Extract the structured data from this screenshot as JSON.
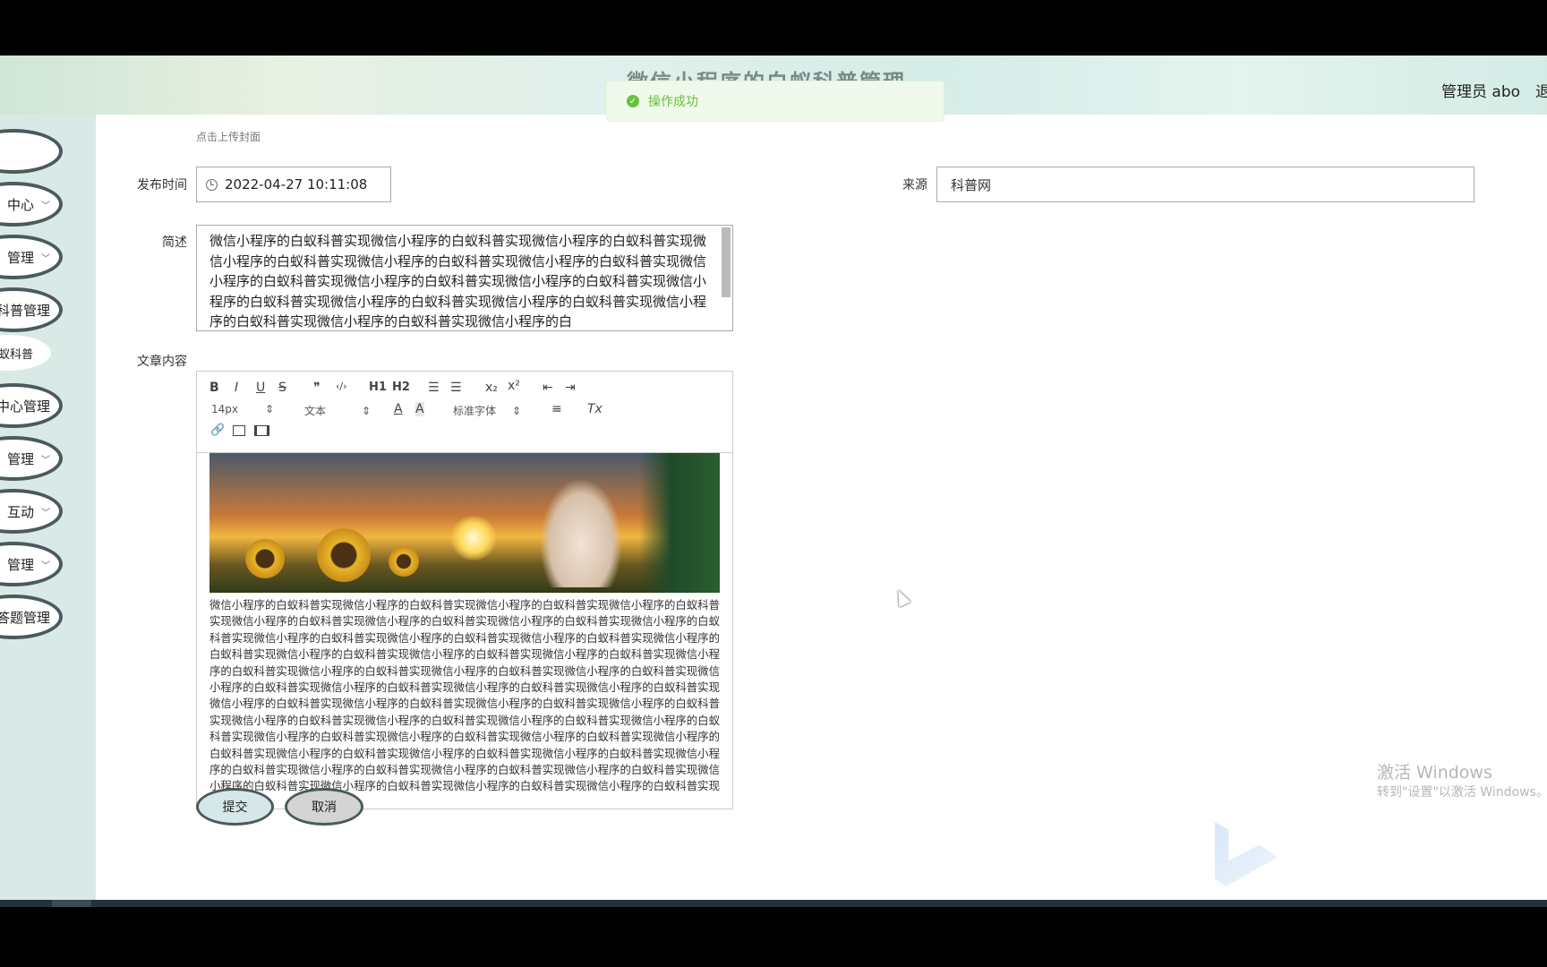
{
  "header": {
    "site_title": "微信小程序的白蚁科普管理",
    "admin_label": "管理员 abo",
    "logout_label": "退"
  },
  "toast": {
    "message": "操作成功"
  },
  "sidebar": {
    "items": [
      {
        "label": ""
      },
      {
        "label": "中心"
      },
      {
        "label": "管理"
      },
      {
        "label": "科普管理"
      },
      {
        "label": "蚁科普"
      },
      {
        "label": "中心管理"
      },
      {
        "label": "管理"
      },
      {
        "label": "互动"
      },
      {
        "label": "管理"
      },
      {
        "label": "答题管理"
      }
    ]
  },
  "form": {
    "upload_hint": "点击上传封面",
    "publish_time_label": "发布时间",
    "publish_time_value": "2022-04-27 10:11:08",
    "source_label": "来源",
    "source_value": "科普网",
    "summary_label": "简述",
    "summary_value": "微信小程序的白蚁科普实现微信小程序的白蚁科普实现微信小程序的白蚁科普实现微信小程序的白蚁科普实现微信小程序的白蚁科普实现微信小程序的白蚁科普实现微信小程序的白蚁科普实现微信小程序的白蚁科普实现微信小程序的白蚁科普实现微信小程序的白蚁科普实现微信小程序的白蚁科普实现微信小程序的白蚁科普实现微信小程序的白蚁科普实现微信小程序的白蚁科普实现微信小程序的白",
    "content_label": "文章内容",
    "submit_label": "提交",
    "cancel_label": "取消"
  },
  "editor": {
    "toolbar": {
      "bold": "B",
      "italic": "I",
      "underline": "U",
      "strike": "S",
      "quote": "❞",
      "code": "‹/›",
      "h1": "H1",
      "h2": "H2",
      "ordered_list": "☰",
      "bullet_list": "☰",
      "subscript": "x₂",
      "superscript": "x²",
      "outdent": "⇤",
      "indent": "⇥",
      "size_value": "14px",
      "header_value": "文本",
      "font_value": "标准字体",
      "color": "A",
      "background": "A",
      "align": "≡",
      "clean": "Tx"
    },
    "body_text": "微信小程序的白蚁科普实现微信小程序的白蚁科普实现微信小程序的白蚁科普实现微信小程序的白蚁科普实现微信小程序的白蚁科普实现微信小程序的白蚁科普实现微信小程序的白蚁科普实现微信小程序的白蚁科普实现微信小程序的白蚁科普实现微信小程序的白蚁科普实现微信小程序的白蚁科普实现微信小程序的白蚁科普实现微信小程序的白蚁科普实现微信小程序的白蚁科普实现微信小程序的白蚁科普实现微信小程序的白蚁科普实现微信小程序的白蚁科普实现微信小程序的白蚁科普实现微信小程序的白蚁科普实现微信小程序的白蚁科普实现微信小程序的白蚁科普实现微信小程序的白蚁科普实现微信小程序的白蚁科普实现微信小程序的白蚁科普实现微信小程序的白蚁科普实现微信小程序的白蚁科普实现微信小程序的白蚁科普实现微信小程序的白蚁科普实现微信小程序的白蚁科普实现微信小程序的白蚁科普实现微信小程序的白蚁科普实现微信小程序的白蚁科普实现微信小程序的白蚁科普实现微信小程序的白蚁科普实现微信小程序的白蚁科普实现微信小程序的白蚁科普实现微信小程序的白蚁科普实现微信小程序的白蚁科普实现微信小程序的白蚁科普实现微信小程序的白蚁科普实现微信小程序的白蚁科普实现微信小程序的白蚁科普实现微信小程序的白蚁科普实现微信小程序的白蚁科普实现微信小程序的白蚁科普实现微信小程序的白蚁科普实现"
  },
  "watermark": {
    "line1": "激活 Windows",
    "line2": "转到\"设置\"以激活 Windows。"
  },
  "colors": {
    "success": "#67c23a",
    "sidebar_bg": "#d9e9e6",
    "pill_border": "#4b5a5c"
  }
}
